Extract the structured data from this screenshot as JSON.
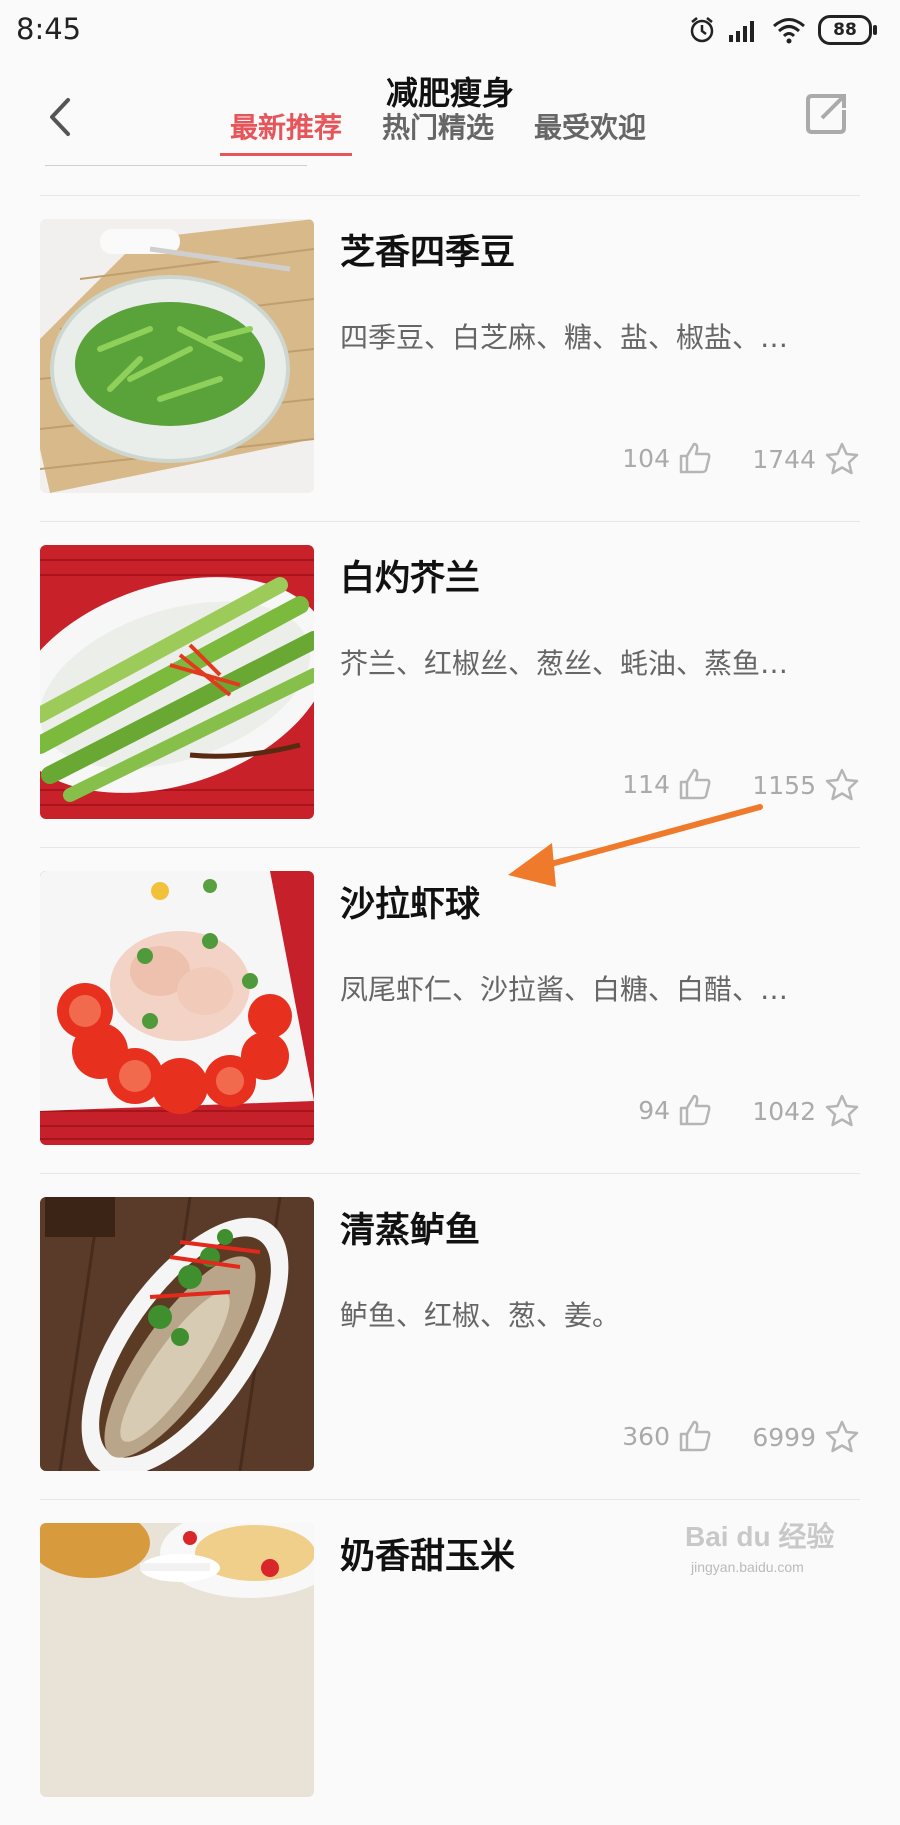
{
  "status_bar": {
    "time": "8:45",
    "battery": "88"
  },
  "header": {
    "title": "减肥瘦身",
    "tabs": [
      {
        "label": "最新推荐",
        "active": true
      },
      {
        "label": "热门精选",
        "active": false
      },
      {
        "label": "最受欢迎",
        "active": false
      }
    ]
  },
  "recipes": [
    {
      "title": "芝香四季豆",
      "ingredients": "四季豆、白芝麻、糖、盐、椒盐、…",
      "likes": "104",
      "favorites": "1744"
    },
    {
      "title": "白灼芥兰",
      "ingredients": "芥兰、红椒丝、葱丝、蚝油、蒸鱼…",
      "likes": "114",
      "favorites": "1155"
    },
    {
      "title": "沙拉虾球",
      "ingredients": "凤尾虾仁、沙拉酱、白糖、白醋、…",
      "likes": "94",
      "favorites": "1042"
    },
    {
      "title": "清蒸鲈鱼",
      "ingredients": "鲈鱼、红椒、葱、姜。",
      "likes": "360",
      "favorites": "6999"
    },
    {
      "title": "奶香甜玉米",
      "ingredients": "",
      "likes": "",
      "favorites": ""
    }
  ],
  "watermark": {
    "brand": "Bai du 经验",
    "url": "jingyan.baidu.com"
  },
  "colors": {
    "accent": "#e6555a",
    "annotation_arrow": "#f07a2c"
  }
}
